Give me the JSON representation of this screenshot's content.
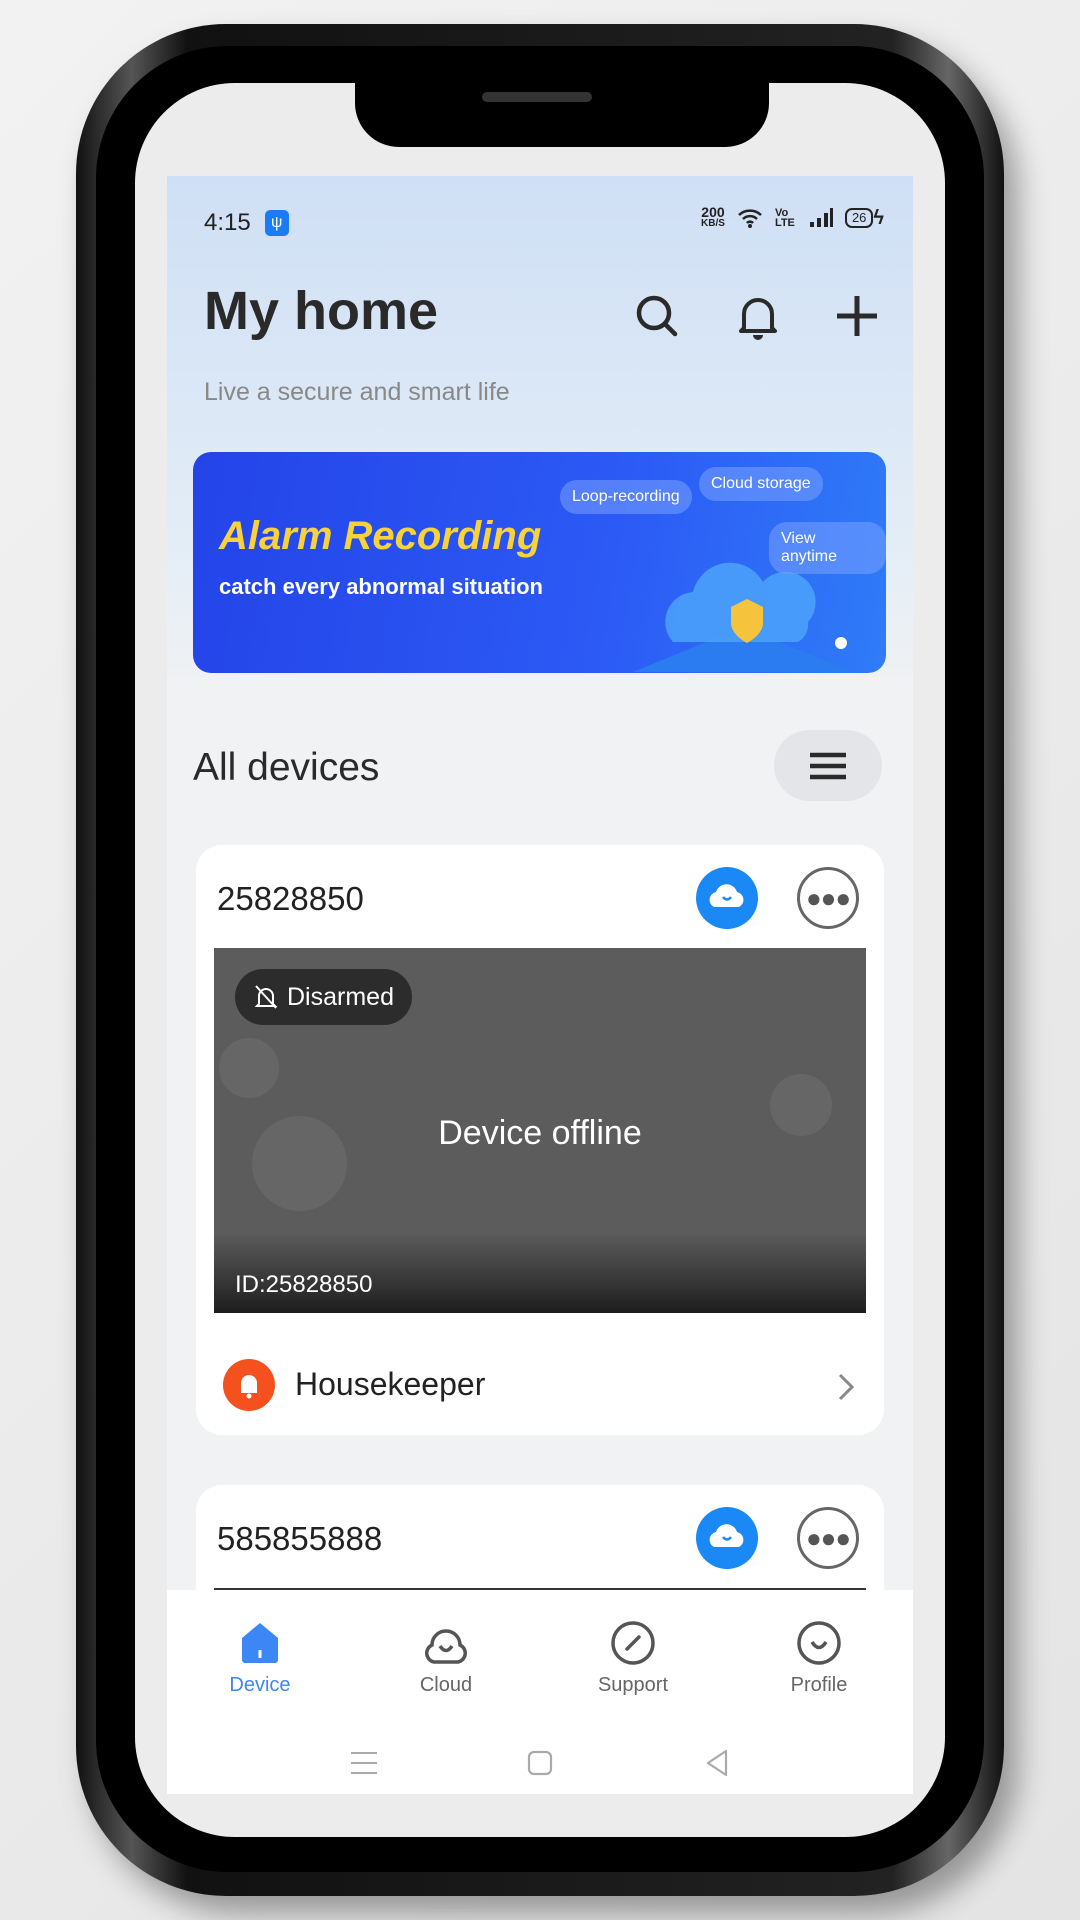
{
  "status_bar": {
    "time": "4:15",
    "net_speed": "200",
    "net_unit": "KB/S",
    "volte": "Vo LTE",
    "battery": "26"
  },
  "header": {
    "title": "My home",
    "subtitle": "Live a secure and smart life"
  },
  "banner": {
    "title": "Alarm Recording",
    "subtitle": "catch every abnormal situation",
    "tags": [
      "Loop-recording",
      "Cloud storage",
      "View anytime"
    ]
  },
  "section": {
    "title": "All devices"
  },
  "devices": [
    {
      "name": "25828850",
      "arm_status": "Disarmed",
      "state": "Device offline",
      "id_label": "ID:25828850",
      "service": "Housekeeper"
    },
    {
      "name": "585855888"
    }
  ],
  "bottom_nav": {
    "items": [
      {
        "label": "Device",
        "active": true
      },
      {
        "label": "Cloud"
      },
      {
        "label": "Support"
      },
      {
        "label": "Profile"
      }
    ]
  },
  "colors": {
    "accent": "#3d86f5",
    "banner_title": "#f8d23a",
    "housekeeper": "#f4511e"
  }
}
